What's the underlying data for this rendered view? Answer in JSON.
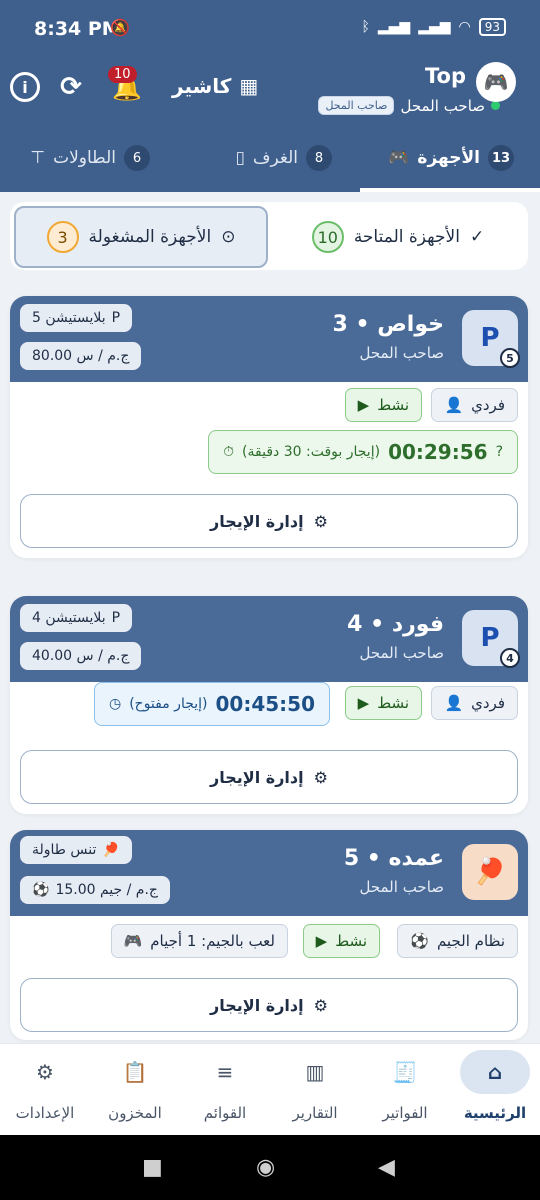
{
  "status": {
    "time": "8:34 PM",
    "battery": "93"
  },
  "header": {
    "title": "Top",
    "owner_label": "صاحب المحل",
    "owner_chip": "صاحب المحل",
    "cashier": "كاشير",
    "notif_count": "10"
  },
  "tabs": [
    {
      "label": "الأجهزة",
      "count": "13",
      "active": true
    },
    {
      "label": "الغرف",
      "count": "8"
    },
    {
      "label": "الطاولات",
      "count": "6"
    }
  ],
  "filters": {
    "available": {
      "label": "الأجهزة المتاحة",
      "count": "10"
    },
    "busy": {
      "label": "الأجهزة المشغولة",
      "count": "3"
    }
  },
  "cards": [
    {
      "name": "خواص • 3",
      "owner": "صاحب المحل",
      "icon_num": "5",
      "type": "بلايستيشن 5",
      "rate": "80.00 ج.م / س",
      "mode": "فردي",
      "status": "نشط",
      "timer_label": "(إيجار بوقت: 30 دقيقة)",
      "timer_value": "00:29:56",
      "manage": "إدارة الإيجار"
    },
    {
      "name": "فورد • 4",
      "owner": "صاحب المحل",
      "icon_num": "4",
      "type": "بلايستيشن 4",
      "rate": "40.00 ج.م / س",
      "mode": "فردي",
      "status": "نشط",
      "timer_label": "(إيجار مفتوح)",
      "timer_value": "00:45:50",
      "manage": "إدارة الإيجار"
    },
    {
      "name": "عمده • 5",
      "owner": "صاحب المحل",
      "type": "تنس طاولة",
      "rate": "15.00 ج.م / جيم",
      "mode": "نظام الجيم",
      "status": "نشط",
      "games": "لعب بالجيم: 1 أجيام",
      "manage": "إدارة الإيجار"
    }
  ],
  "nav": [
    {
      "label": "الرئيسية",
      "icon": "home-icon",
      "active": true
    },
    {
      "label": "الفواتير",
      "icon": "invoice-icon"
    },
    {
      "label": "التقارير",
      "icon": "chart-icon"
    },
    {
      "label": "القوائم",
      "icon": "menu-icon"
    },
    {
      "label": "المخزون",
      "icon": "clipboard-icon"
    },
    {
      "label": "الإعدادات",
      "icon": "gear-icon"
    }
  ],
  "colors": {
    "primary": "#3f5f8c",
    "active_green": "#2e6e2c",
    "badge_red": "#c11e2b"
  }
}
